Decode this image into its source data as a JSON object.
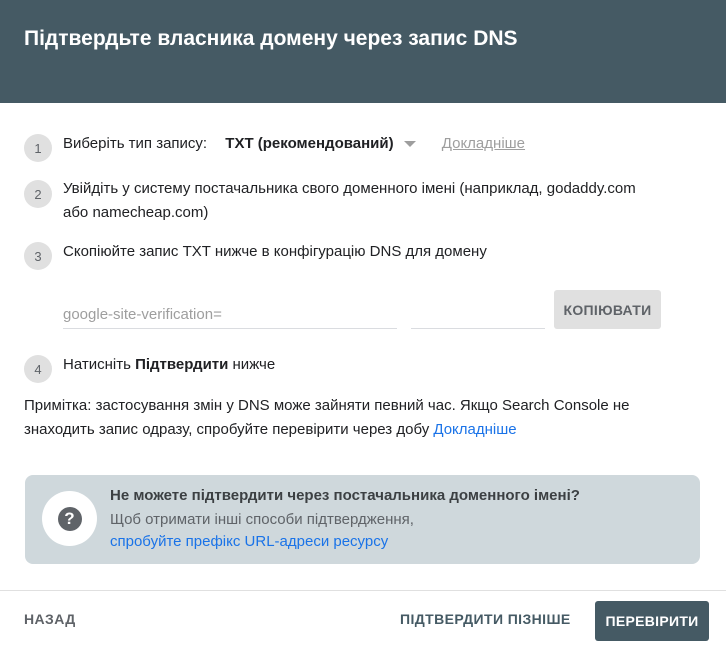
{
  "header": {
    "title": "Підтвердьте власника домену через запис DNS"
  },
  "steps": [
    {
      "num": "1",
      "label": "Виберіть тип запису:",
      "record_type": "TXT (рекомендований)",
      "details_link": "Докладніше"
    },
    {
      "num": "2",
      "line1": "Увійдіть у систему постачальника свого доменного імені (наприклад, godaddy.com",
      "line2": "або namecheap.com)"
    },
    {
      "num": "3",
      "text": "Скопіюйте запис TXT нижче в конфігурацію DNS для домену"
    },
    {
      "num": "4",
      "text_before": "Натисніть ",
      "text_bold": "Підтвердити",
      "text_after": " нижче"
    }
  ],
  "txt_record": {
    "value": "google-site-verification=",
    "copy_label": "КОПІЮВАТИ"
  },
  "note": {
    "text": "Примітка: застосування змін у DNS може зайняти певний час. Якщо Search Console не знаходить запис одразу, спробуйте перевірити через добу ",
    "link": "Докладніше"
  },
  "info_box": {
    "title": "Не можете підтвердити через постачальника доменного імені?",
    "line2": "Щоб отримати інші способи підтвердження,",
    "link": "спробуйте префікс URL-адреси ресурсу",
    "icon_glyph": "?"
  },
  "footer": {
    "back_label": "НАЗАД",
    "later_label": "ПІДТВЕРДИТИ ПІЗНІШЕ",
    "verify_label": "ПЕРЕВІРИТИ"
  }
}
